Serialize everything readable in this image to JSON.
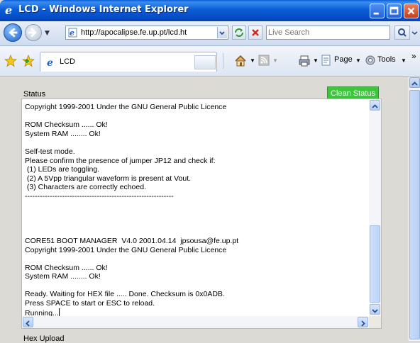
{
  "window": {
    "title": "LCD - Windows Internet Explorer"
  },
  "address_bar": {
    "url": "http://apocalipse.fe.up.pt/lcd.ht",
    "search_placeholder": "Live Search"
  },
  "command_bar": {
    "tab_label": "LCD",
    "page_menu": "Page",
    "tools_menu": "Tools",
    "overflow": "»"
  },
  "status_panel": {
    "label": "Status",
    "clean_button": "Clean Status",
    "log_lines": [
      "Copyright 1999-2001 Under the GNU General Public Licence",
      "",
      "ROM Checksum ...... Ok!",
      "System RAM ........ Ok!",
      "",
      "Self-test mode.",
      "Please confirm the presence of jumper JP12 and check if:",
      " (1) LEDs are toggling.",
      " (2) A 5Vpp triangular waveform is present at Vout.",
      " (3) Characters are correctly echoed.",
      "------------------------------------------------------------",
      "",
      "",
      "",
      "",
      "CORE51 BOOT MANAGER  V4.0 2001.04.14  jpsousa@fe.up.pt",
      "Copyright 1999-2001 Under the GNU General Public Licence",
      "",
      "ROM Checksum ...... Ok!",
      "System RAM ........ Ok!",
      "",
      "Ready. Waiting for HEX file ..... Done. Checksum is 0x0ADB.",
      "Press SPACE to start or ESC to reload.",
      "Running..."
    ]
  },
  "hex_upload": {
    "label": "Hex Upload"
  },
  "colors": {
    "clean_button_bg": "#3ec43e",
    "titlebar": "#0b5ed6"
  }
}
